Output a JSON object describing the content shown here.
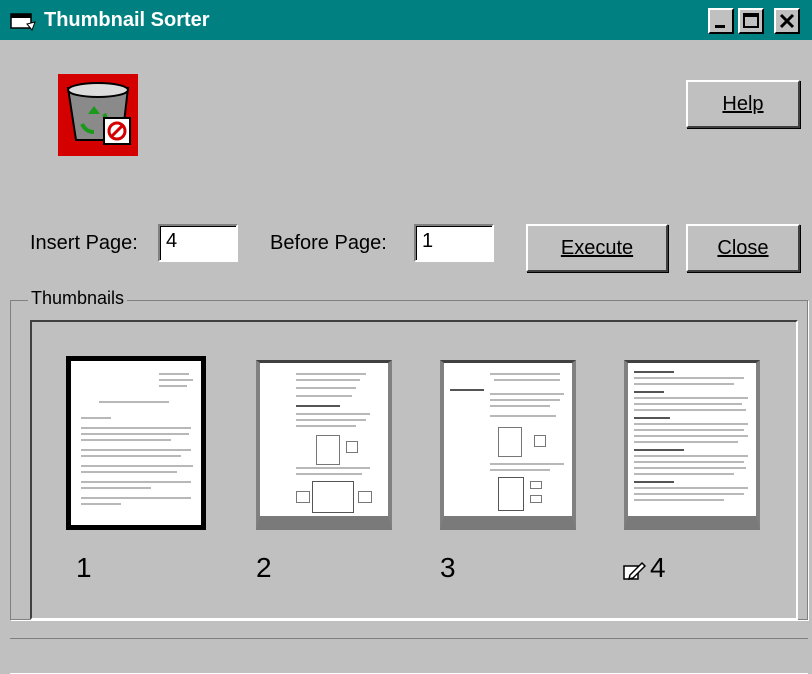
{
  "window": {
    "title": "Thumbnail Sorter"
  },
  "controls": {
    "help": "Help",
    "insert_label": "Insert Page:",
    "insert_value": "4",
    "before_label": "Before Page:",
    "before_value": "1",
    "execute": "Execute",
    "close": "Close"
  },
  "thumbnails": {
    "group_label": "Thumbnails",
    "pages": [
      {
        "number": "1",
        "selected": true
      },
      {
        "number": "2",
        "selected": false
      },
      {
        "number": "3",
        "selected": false
      },
      {
        "number": "4",
        "selected": false,
        "edited": true
      }
    ]
  },
  "colors": {
    "titlebar": "#008080",
    "face": "#c0c0c0",
    "logo_bg": "#d40000"
  },
  "icons": [
    "app-window-icon",
    "minimize-icon",
    "maximize-icon",
    "close-icon",
    "recycle-bin-logo-icon",
    "edit-pencil-icon"
  ]
}
